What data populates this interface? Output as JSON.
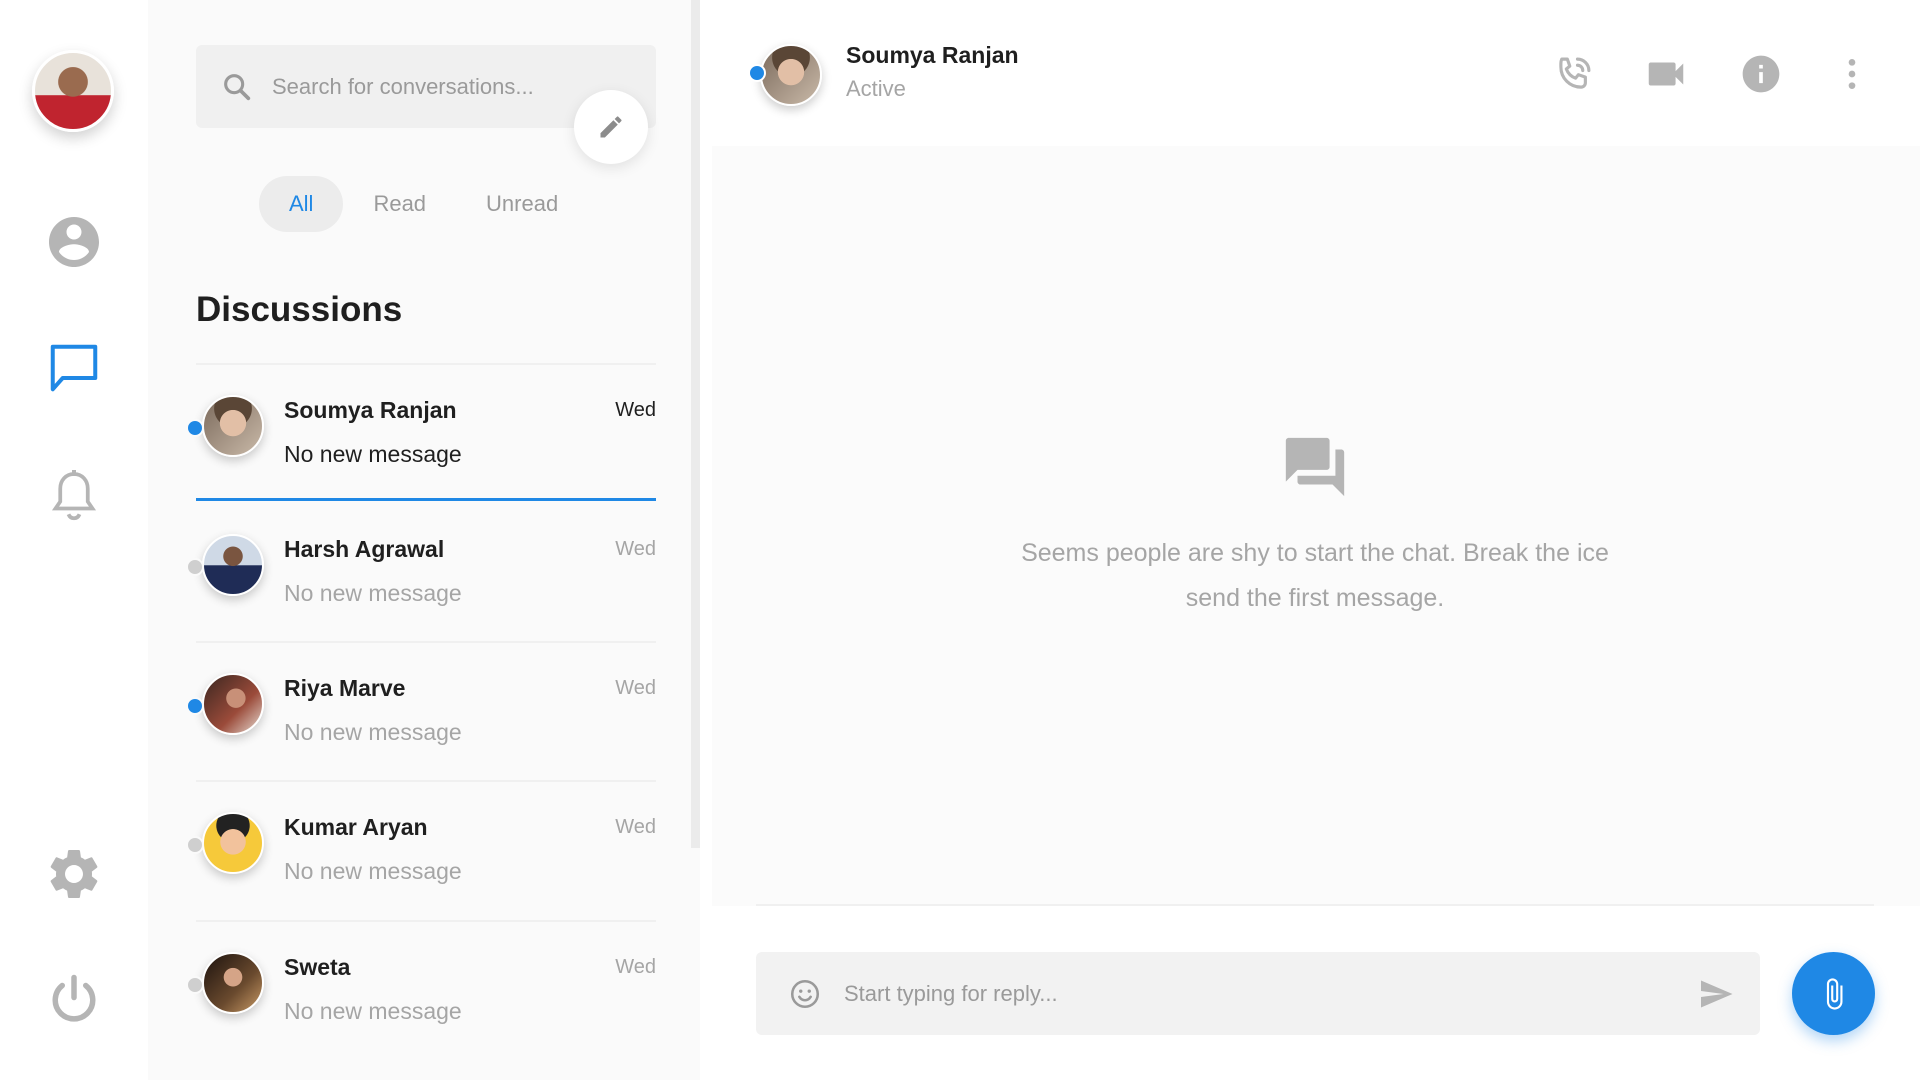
{
  "sidebar": {
    "profile_avatar": "user-avatar",
    "nav": [
      {
        "icon": "account-circle-icon",
        "active": false
      },
      {
        "icon": "chat-bubble-icon",
        "active": true
      },
      {
        "icon": "bell-icon",
        "active": false
      },
      {
        "icon": "gear-icon",
        "active": false
      },
      {
        "icon": "power-icon",
        "active": false
      }
    ]
  },
  "search": {
    "placeholder": "Search for conversations..."
  },
  "filters": [
    "All",
    "Read",
    "Unread"
  ],
  "active_filter": "All",
  "discussions_title": "Discussions",
  "conversations": [
    {
      "name": "Soumya Ranjan",
      "message": "No new message",
      "time": "Wed",
      "online": true,
      "selected": true
    },
    {
      "name": "Harsh Agrawal",
      "message": "No new message",
      "time": "Wed",
      "online": false,
      "selected": false
    },
    {
      "name": "Riya Marve",
      "message": "No new message",
      "time": "Wed",
      "online": true,
      "selected": false
    },
    {
      "name": "Kumar Aryan",
      "message": "No new message",
      "time": "Wed",
      "online": false,
      "selected": false
    },
    {
      "name": "Sweta",
      "message": "No new message",
      "time": "Wed",
      "online": false,
      "selected": false
    }
  ],
  "chat": {
    "name": "Soumya Ranjan",
    "status": "Active",
    "actions": [
      "phone-call-icon",
      "video-camera-icon",
      "info-icon",
      "more-vertical-icon"
    ],
    "empty_message": "Seems people are shy to start the chat. Break the ice send the first message.",
    "reply_placeholder": "Start typing for reply..."
  },
  "colors": {
    "accent": "#1f88e5",
    "online": "#1f88e5",
    "offline": "#cfcfcf",
    "icon_gray": "#b5b5b5"
  }
}
